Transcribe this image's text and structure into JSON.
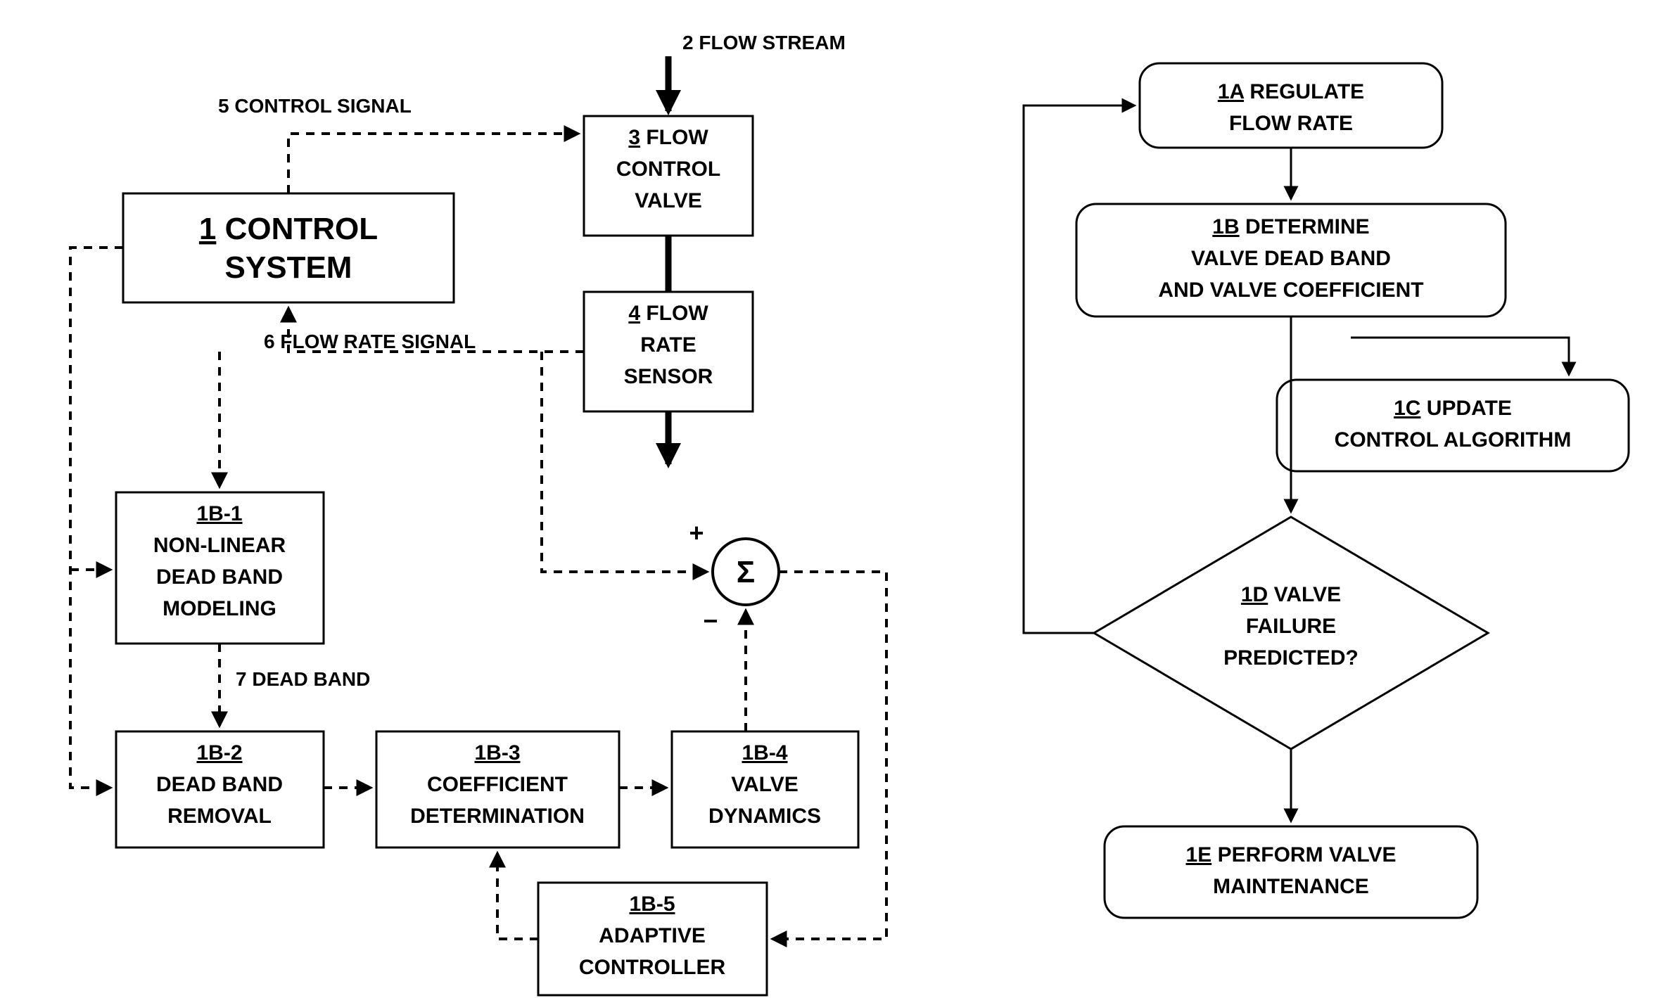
{
  "left": {
    "flowStream": {
      "num": "2",
      "label": "FLOW STREAM"
    },
    "controlSystem": {
      "num": "1",
      "label": "CONTROL\nSYSTEM"
    },
    "flowControlValve": {
      "num": "3",
      "label": "FLOW\nCONTROL\nVALVE"
    },
    "flowRateSensor": {
      "num": "4",
      "label": "FLOW\nRATE\nSENSOR"
    },
    "controlSignal": {
      "num": "5",
      "label": "CONTROL SIGNAL"
    },
    "flowRateSignal": {
      "num": "6",
      "label": "FLOW RATE SIGNAL"
    },
    "deadBand": {
      "num": "7",
      "label": "DEAD BAND"
    },
    "b1": {
      "num": "1B-1",
      "label": "NON-LINEAR\nDEAD BAND\nMODELING"
    },
    "b2": {
      "num": "1B-2",
      "label": "DEAD BAND\nREMOVAL"
    },
    "b3": {
      "num": "1B-3",
      "label": "COEFFICIENT\nDETERMINATION"
    },
    "b4": {
      "num": "1B-4",
      "label": "VALVE\nDYNAMICS"
    },
    "b5": {
      "num": "1B-5",
      "label": "ADAPTIVE\nCONTROLLER"
    },
    "sigma": "Σ",
    "plus": "+",
    "minus": "−"
  },
  "right": {
    "a": {
      "num": "1A",
      "label": "REGULATE\nFLOW RATE"
    },
    "b": {
      "num": "1B",
      "label": "DETERMINE\nVALVE DEAD BAND\nAND VALVE COEFFICIENT"
    },
    "c": {
      "num": "1C",
      "label": "UPDATE\nCONTROL ALGORITHM"
    },
    "d": {
      "num": "1D",
      "label": "VALVE\nFAILURE\nPREDICTED?"
    },
    "e": {
      "num": "1E",
      "label": "PERFORM VALVE\nMAINTENANCE"
    }
  }
}
